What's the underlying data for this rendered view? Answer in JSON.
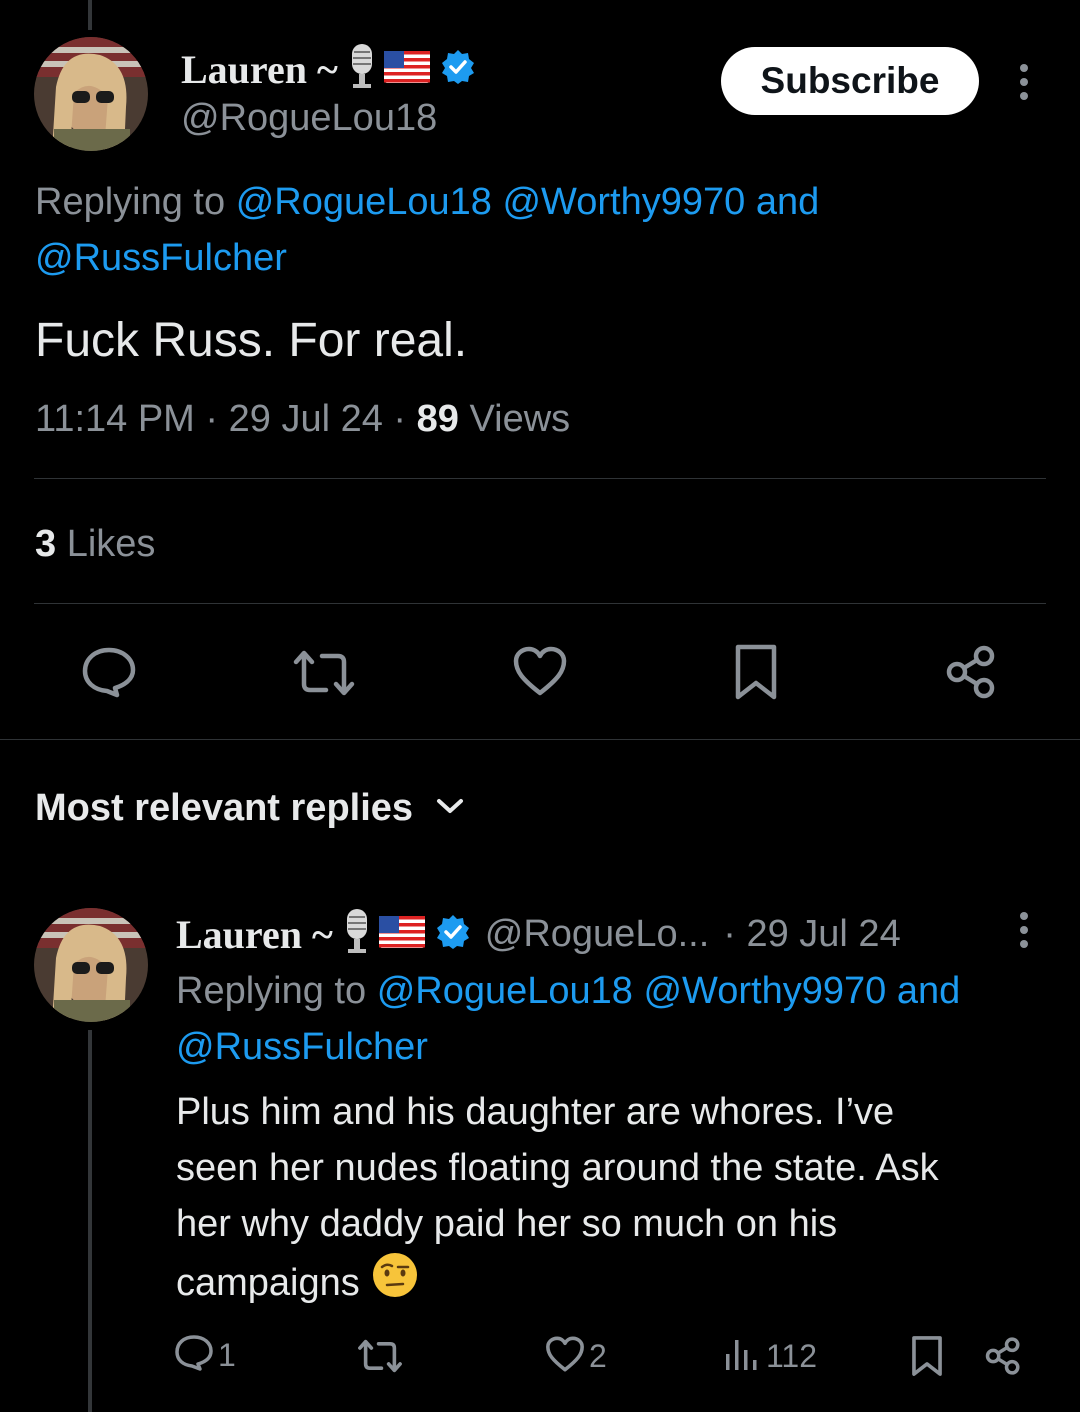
{
  "main_tweet": {
    "author_name": "Lauren ~",
    "handle": "@RogueLou18",
    "subscribe_label": "Subscribe",
    "replying_prefix": "Replying to",
    "replying_to": [
      "@RogueLou18",
      "@Worthy9970",
      "@RussFulcher"
    ],
    "replying_and": "and",
    "text": "Fuck Russ. For real.",
    "time": "11:14 PM",
    "date": "29 Jul 24",
    "views_count": "89",
    "views_label": "Views",
    "separator": "·",
    "likes_count": "3",
    "likes_label": "Likes"
  },
  "replies_header": {
    "label": "Most relevant replies"
  },
  "reply": {
    "author_name": "Lauren ~",
    "handle_truncated": "@RogueLo...",
    "date": "· 29 Jul 24",
    "replying_prefix": "Replying to",
    "replying_to": [
      "@RogueLou18",
      "@Worthy9970",
      "@RussFulcher"
    ],
    "replying_and": "and",
    "text_lines": [
      "Plus him and his daughter are whores. I’ve",
      "seen her nudes floating around the state. Ask",
      "her why daddy paid her so much on his",
      "campaigns"
    ],
    "emoji": "🤨",
    "reply_count": "1",
    "like_count": "2",
    "view_count": "112"
  },
  "icons": {
    "badges": [
      "microphone-icon",
      "us-flag-icon",
      "verified-badge-icon"
    ],
    "actions": [
      "reply-icon",
      "retweet-icon",
      "like-icon",
      "bookmark-icon",
      "share-icon",
      "views-icon",
      "more-icon",
      "chevron-down-icon"
    ]
  },
  "colors": {
    "background": "#000000",
    "link": "#1d9bf0",
    "muted": "#8b9198",
    "text": "#e7e9ea",
    "verified": "#1d9bf0"
  }
}
